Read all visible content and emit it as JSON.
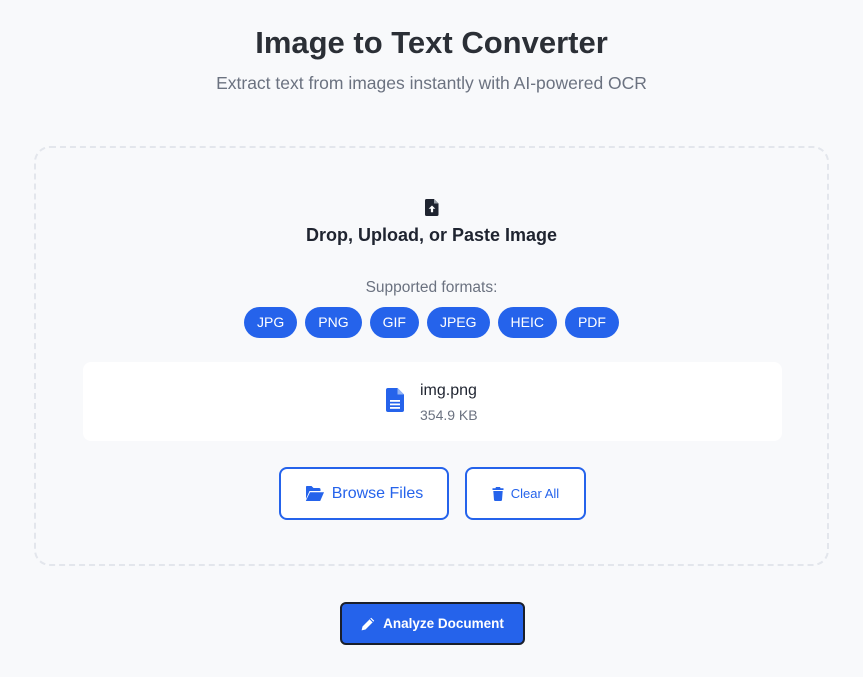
{
  "header": {
    "title": "Image to Text Converter",
    "subtitle": "Extract text from images instantly with AI-powered OCR"
  },
  "dropzone": {
    "icon": "file-upload-icon",
    "title": "Drop, Upload, or Paste Image",
    "formats_label": "Supported formats:",
    "formats": [
      "JPG",
      "PNG",
      "GIF",
      "JPEG",
      "HEIC",
      "PDF"
    ]
  },
  "file": {
    "icon": "document-icon",
    "name": "img.png",
    "size": "354.9 KB"
  },
  "actions": {
    "browse_label": "Browse Files",
    "browse_icon": "folder-open-icon",
    "clear_label": "Clear All",
    "clear_icon": "trash-icon"
  },
  "analyze": {
    "label": "Analyze Document",
    "icon": "pencil-icon"
  },
  "colors": {
    "accent": "#2563eb",
    "background": "#f8f9fb",
    "text": "#1f2430",
    "muted": "#6b7280"
  }
}
